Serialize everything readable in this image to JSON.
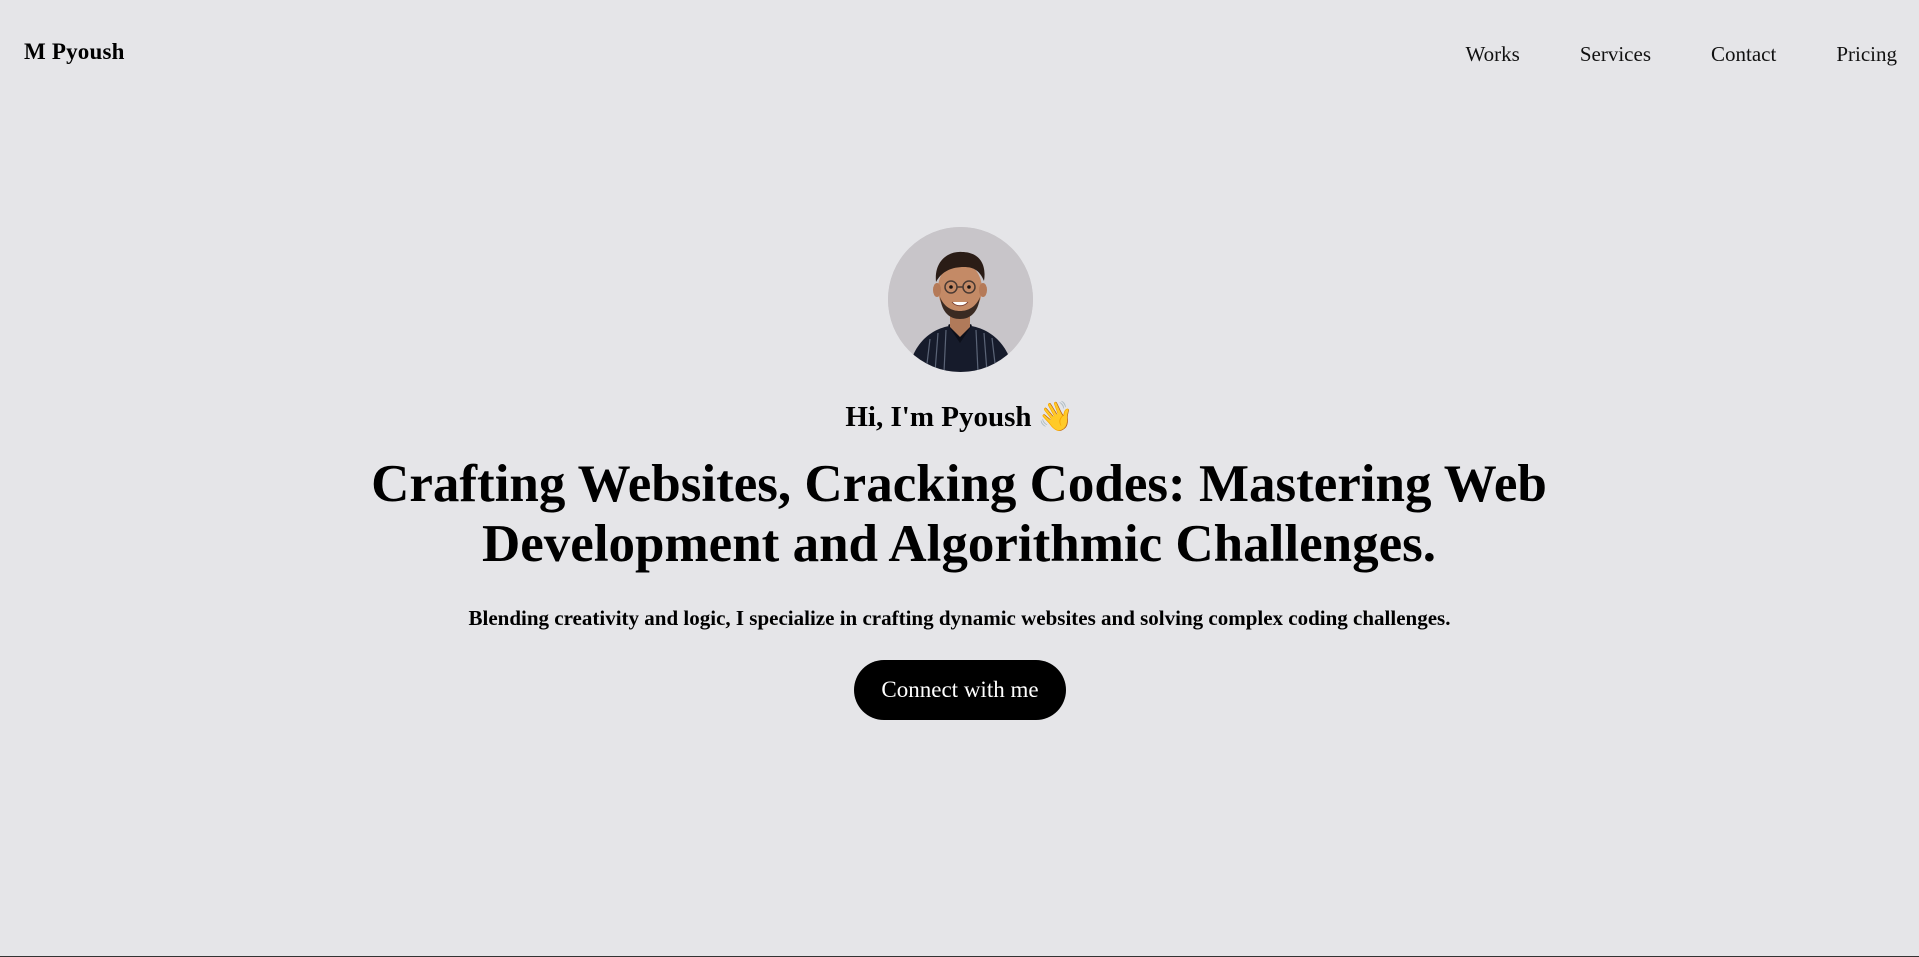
{
  "navbar": {
    "brand": "M Pyoush",
    "links": [
      "Works",
      "Services",
      "Contact",
      "Pricing"
    ]
  },
  "hero": {
    "avatar_alt": "profile photo",
    "greeting": "Hi, I'm Pyoush",
    "greeting_emoji": "👋",
    "headline": "Crafting Websites, Cracking Codes: Mastering Web Development and Algorithmic Challenges.",
    "subtext": "Blending creativity and logic, I specialize in crafting dynamic websites and solving complex coding challenges.",
    "cta_label": "Connect with me"
  },
  "colors": {
    "background": "#e5e5e8",
    "button_bg": "#000000",
    "button_text": "#ffffff",
    "avatar_bg": "#c8c5c9"
  },
  "icons": {
    "wave": "waving-hand-icon"
  }
}
